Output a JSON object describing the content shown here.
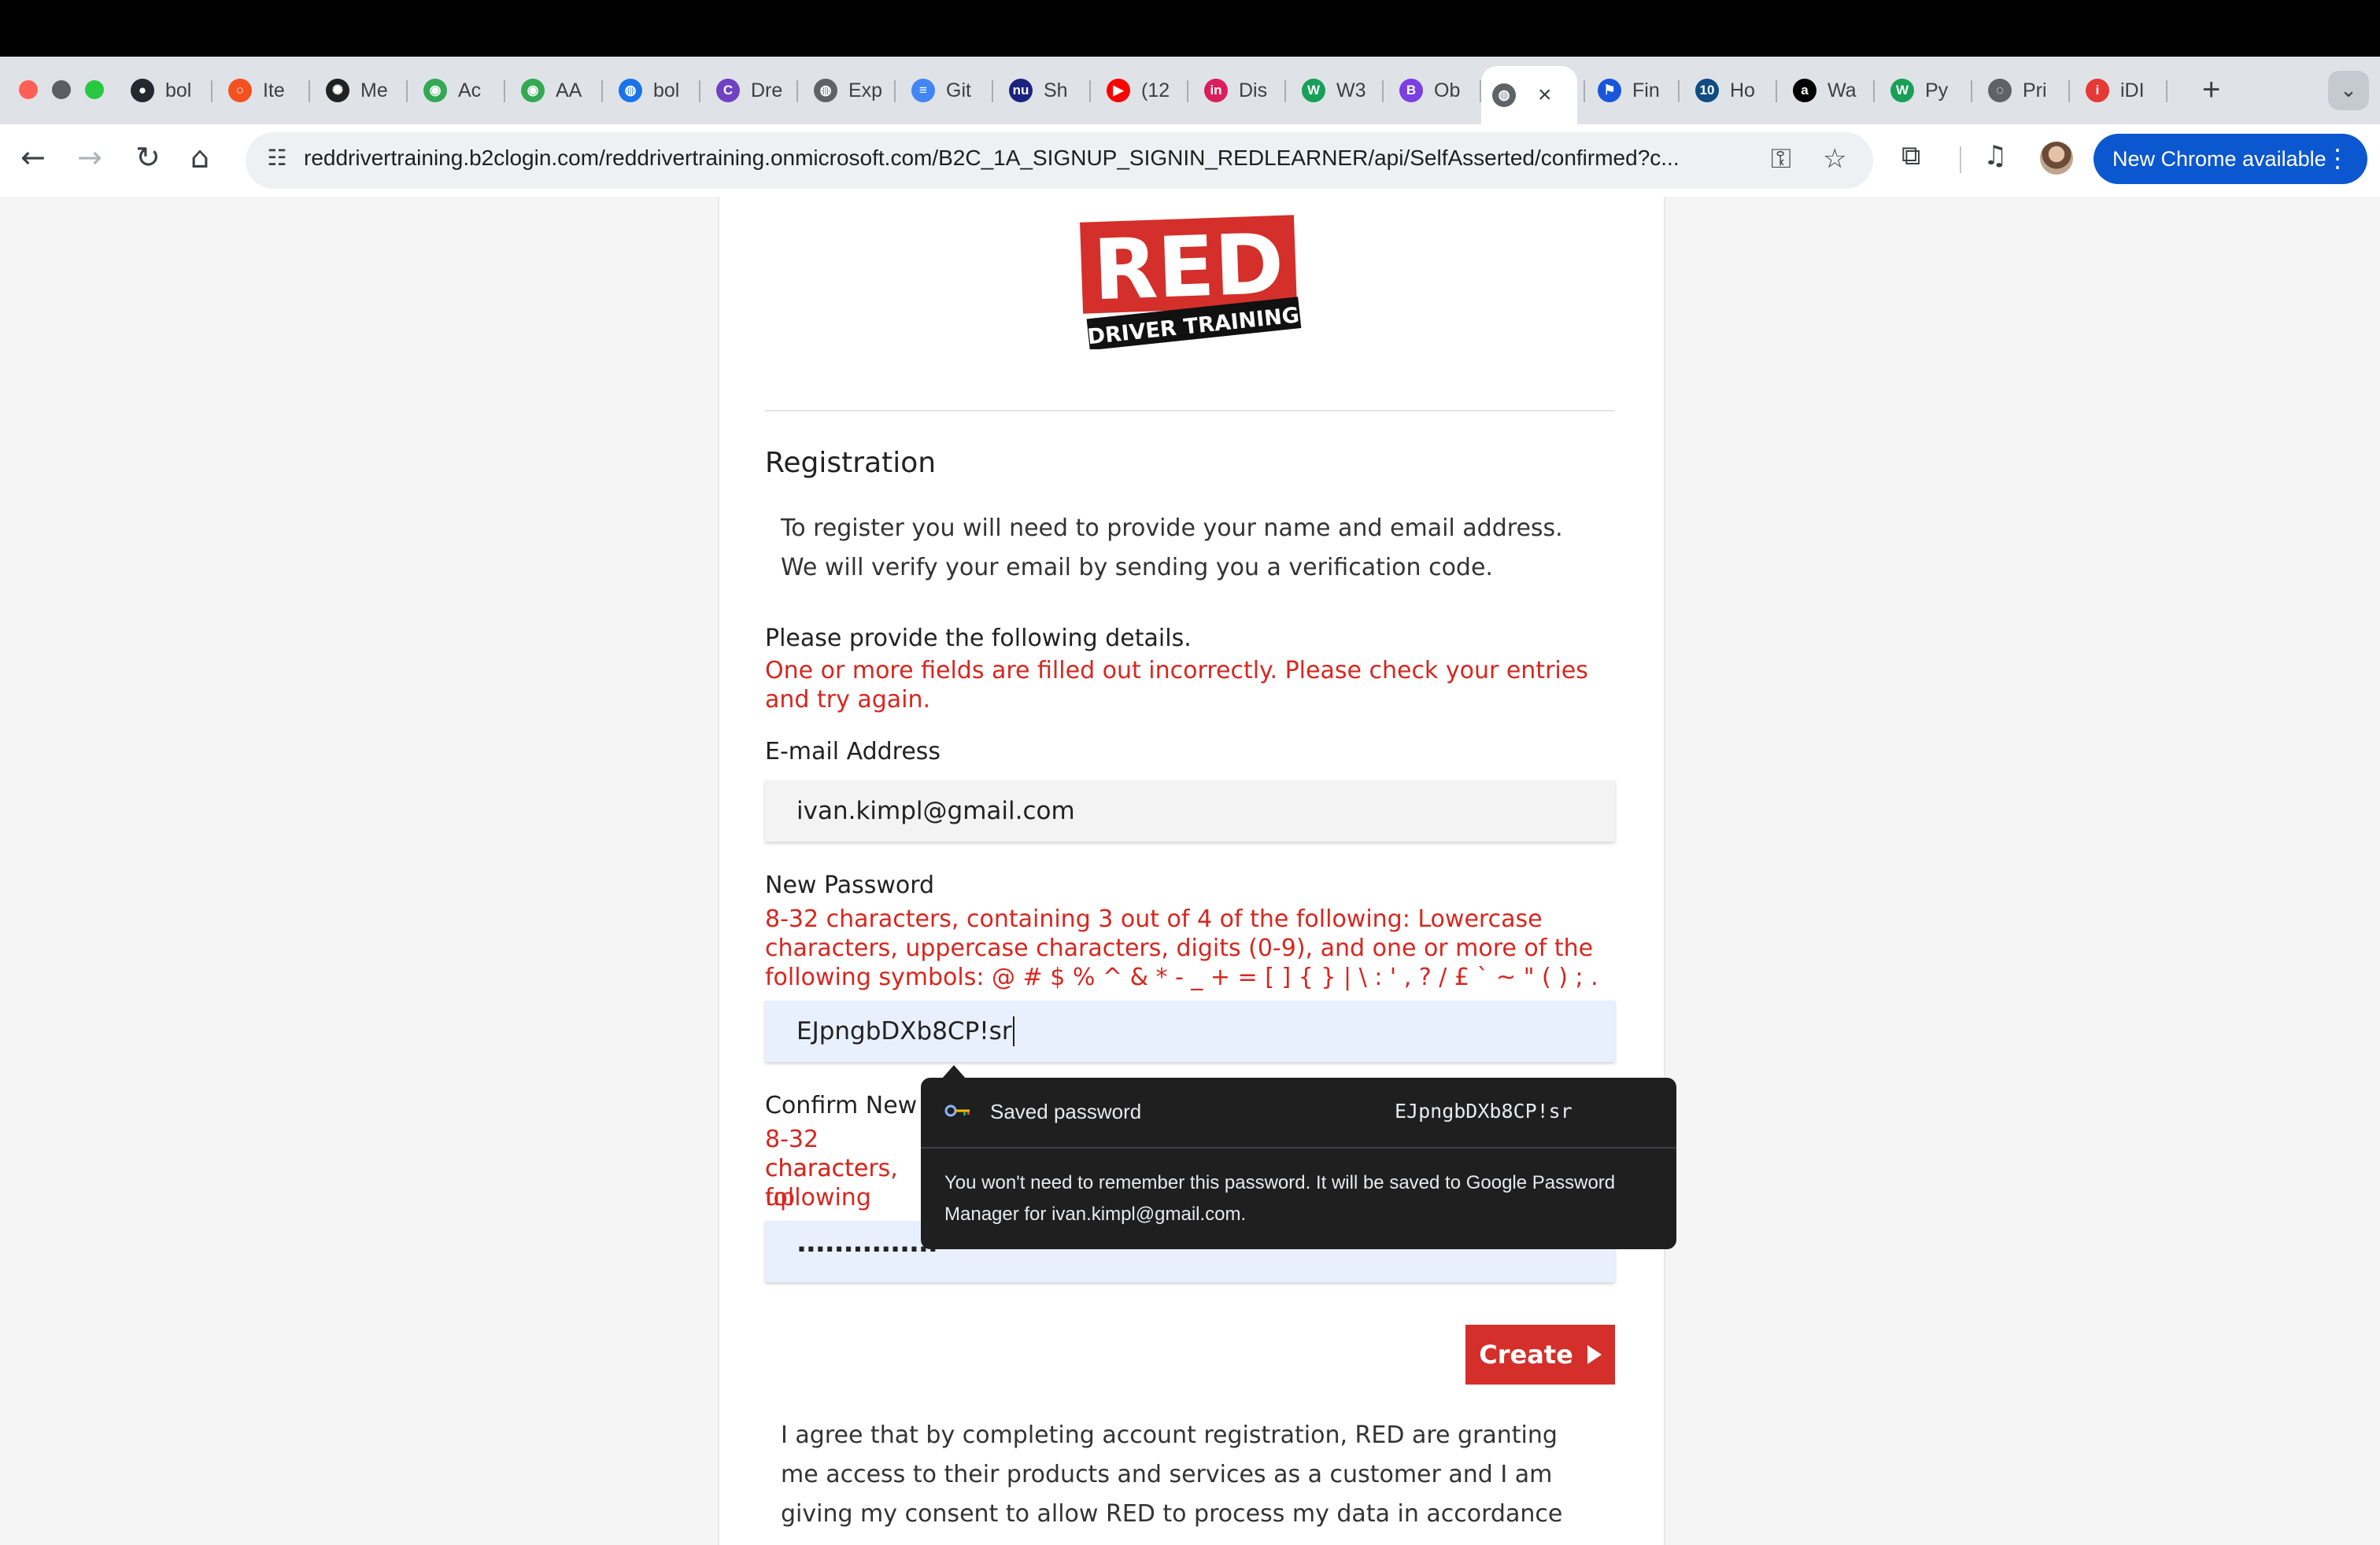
{
  "browser": {
    "tabs": [
      {
        "label": "bol",
        "icon": "github-icon",
        "color": "#24292f"
      },
      {
        "label": "Ite",
        "icon": "ring-icon",
        "color": "#f4511e"
      },
      {
        "label": "Me",
        "icon": "openai-icon",
        "color": "#222222"
      },
      {
        "label": "Ac",
        "icon": "maps-icon",
        "color": "#34a853"
      },
      {
        "label": "AA",
        "icon": "maps-icon",
        "color": "#34a853"
      },
      {
        "label": "bol",
        "icon": "globe-icon",
        "color": "#1a73e8"
      },
      {
        "label": "Dre",
        "icon": "c-icon",
        "color": "#6f42c1"
      },
      {
        "label": "Exp",
        "icon": "globe-icon",
        "color": "#5f6368"
      },
      {
        "label": "Git",
        "icon": "doc-icon",
        "color": "#4285f4"
      },
      {
        "label": "Sh",
        "icon": "nu-icon",
        "color": "#1a237e"
      },
      {
        "label": "(12",
        "icon": "youtube-icon",
        "color": "#ff0000"
      },
      {
        "label": "Dis",
        "icon": "invision-icon",
        "color": "#dc1d5b"
      },
      {
        "label": "W3",
        "icon": "w-icon",
        "color": "#18a058"
      },
      {
        "label": "Ob",
        "icon": "b-icon",
        "color": "#7b3fe4"
      },
      {
        "label": "",
        "icon": "globe-icon",
        "color": "#5f6368",
        "active": true
      },
      {
        "label": "Fin",
        "icon": "flag-icon",
        "color": "#1a56db"
      },
      {
        "label": "Ho",
        "icon": "ten-icon",
        "color": "#0f4c81"
      },
      {
        "label": "Wa",
        "icon": "a-icon",
        "color": "#000000"
      },
      {
        "label": "Py",
        "icon": "w-icon",
        "color": "#18a058"
      },
      {
        "label": "Pri",
        "icon": "loading-icon",
        "color": "#5f6368"
      },
      {
        "label": "iDI",
        "icon": "i-icon",
        "color": "#e53935"
      }
    ],
    "new_tab_glyph": "+",
    "close_glyph": "×",
    "url": "reddrivertraining.b2clogin.com/reddrivertraining.onmicrosoft.com/B2C_1A_SIGNUP_SIGNIN_REDLEARNER/api/SelfAsserted/confirmed?c...",
    "update_label": "New Chrome available"
  },
  "page": {
    "logo": {
      "top": "RED",
      "bottom": "DRIVER TRAINING"
    },
    "heading": "Registration",
    "intro": [
      "To register you will need to provide your name and email address.",
      "We will verify your email by sending you a verification code."
    ],
    "provide_details": "Please provide the following details.",
    "form_error": "One or more fields are filled out incorrectly. Please check your entries and try again.",
    "email": {
      "label": "E-mail Address",
      "value": "ivan.kimpl@gmail.com"
    },
    "new_password": {
      "label": "New Password",
      "hint": "8-32 characters, containing 3 out of 4 of the following: Lowercase characters, uppercase characters, digits (0-9), and one or more of the following symbols: @ # $ % ^ & * - _ + = [ ] { } | \\ : ' , ? / £ ` ~ \" ( ) ; .",
      "value": "EJpngbDXb8CP!sr"
    },
    "confirm_password": {
      "label": "Confirm New",
      "hint_lines": [
        "8-32 characte",
        "characters, up",
        "following sym"
      ],
      "masked_value": "..............."
    },
    "create_button": "Create",
    "consent": "I agree that by completing account registration, RED are granting me access to their products and services as a customer and I am giving my consent to allow RED to process my data in accordance"
  },
  "password_popup": {
    "title": "Saved password",
    "password": "EJpngbDXb8CP!sr",
    "note": "You won't need to remember this password. It will be saved to Google Password Manager for ivan.kimpl@gmail.com."
  },
  "colors": {
    "error_red": "#d8261f",
    "button_red": "#d42f2a",
    "autofill_blue": "#e8f0fe",
    "chrome_update_blue": "#0b57d0"
  }
}
